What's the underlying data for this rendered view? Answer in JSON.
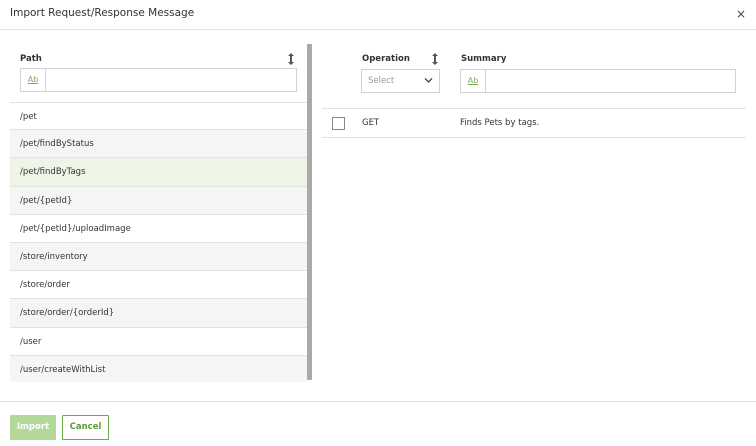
{
  "dialog": {
    "title": "Import Request/Response Message",
    "close_glyph": "×"
  },
  "left": {
    "path_header": "Path",
    "filter_toggle": "Ab",
    "filter_value": "",
    "paths": [
      "/pet",
      "/pet/findByStatus",
      "/pet/findByTags",
      "/pet/{petId}",
      "/pet/{petId}/uploadImage",
      "/store/inventory",
      "/store/order",
      "/store/order/{orderId}",
      "/user",
      "/user/createWithList"
    ],
    "selected_index": 2
  },
  "right": {
    "operation_header": "Operation",
    "summary_header": "Summary",
    "operation_select": "Select",
    "summary_filter_toggle": "Ab",
    "summary_filter_value": "",
    "operations": [
      {
        "method": "GET",
        "summary": "Finds Pets by tags.",
        "checked": false
      }
    ]
  },
  "footer": {
    "import_label": "Import",
    "cancel_label": "Cancel"
  },
  "colors": {
    "accent": "#6aab47",
    "accent_disabled": "#b3d99a",
    "selected_row": "#eef5e7"
  }
}
